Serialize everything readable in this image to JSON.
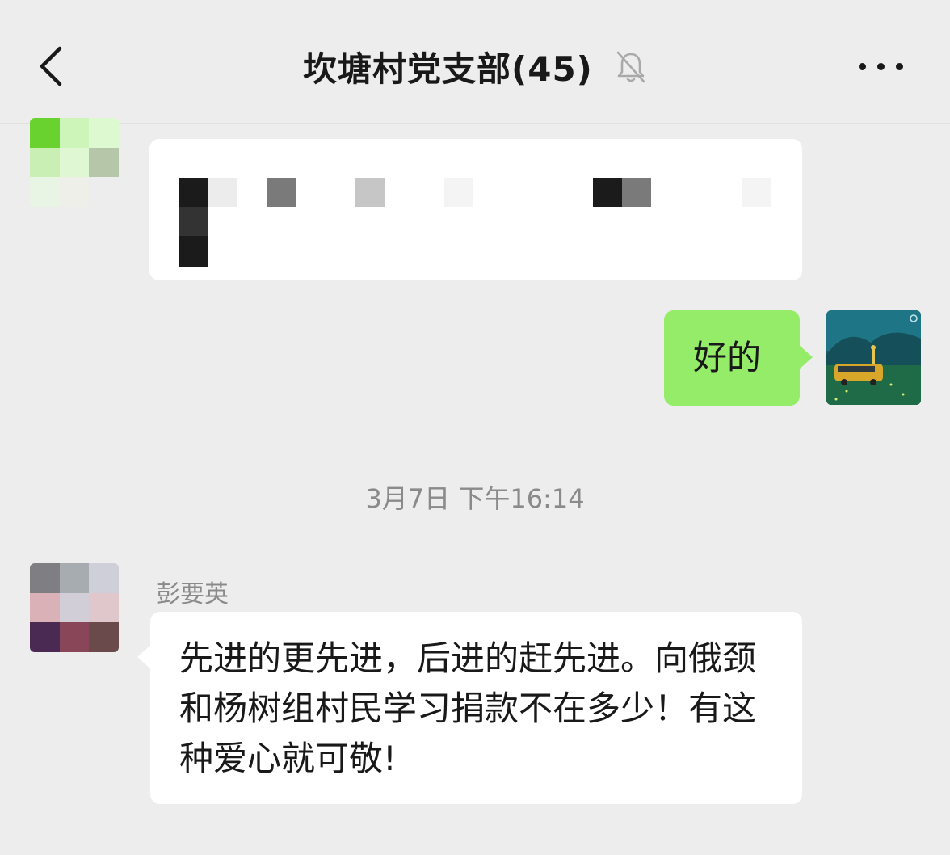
{
  "header": {
    "title": "坎塘村党支部(45)",
    "back_icon": "chevron-left-icon",
    "mute_icon": "bell-off-icon",
    "more_icon": "more-dots-icon"
  },
  "messages": [
    {
      "id": "msg1",
      "direction": "incoming",
      "sender": "",
      "text": "",
      "avatar_colors": [
        "#6ad22e",
        "#cdf4b9",
        "#ddf9cf",
        "#c9efb4",
        "#dff7d3",
        "#b5c6a9",
        "#e8f5e4",
        "#efefe9",
        "#ededed"
      ],
      "redaction_blocks": [
        "#1b1b1b",
        "#ececec",
        "#7a7a7a",
        "#c6c6c6",
        "#f4f4f4",
        "#1b1b1b",
        "#7a7a7a",
        "#f4f4f4",
        "#333333",
        "#1b1b1b"
      ]
    },
    {
      "id": "msg2",
      "direction": "outgoing",
      "text": "好的",
      "bubble_color": "#95ec69",
      "avatar_desc": "yellow-van-night-avatar"
    },
    {
      "id": "sep1",
      "type": "timestamp",
      "text": "3月7日 下午16:14"
    },
    {
      "id": "msg3",
      "direction": "incoming",
      "sender": "彭要英",
      "text": "先进的更先进，后进的赶先进。向俄颈和杨树组村民学习捐款不在多少！有这种爱心就可敬!",
      "avatar_colors": [
        "#7f7f83",
        "#a7acb1",
        "#cfcfd9",
        "#d9b1b7",
        "#d2ced8",
        "#e0c7cb",
        "#4a2a52",
        "#8a4659",
        "#6b4a4c"
      ]
    }
  ],
  "colors": {
    "background": "#ededed",
    "incoming_bubble": "#ffffff",
    "outgoing_bubble": "#95ec69",
    "name_gray": "#8a8a8a",
    "text": "#191919"
  }
}
